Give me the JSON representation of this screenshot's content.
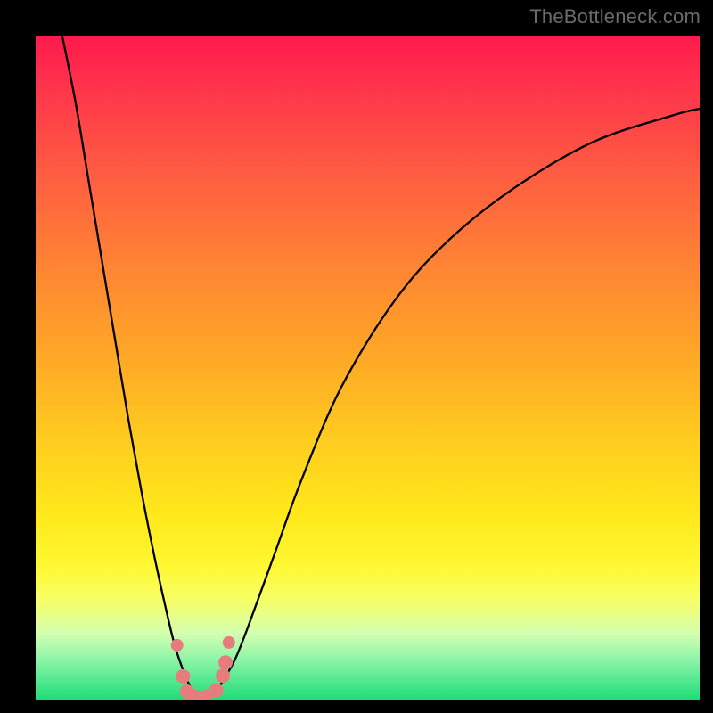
{
  "watermark": "TheBottleneck.com",
  "chart_data": {
    "type": "line",
    "title": "",
    "xlabel": "",
    "ylabel": "",
    "xlim": [
      0,
      100
    ],
    "ylim": [
      0,
      100
    ],
    "grid": false,
    "legend": false,
    "series": [
      {
        "name": "bottleneck-curve",
        "x": [
          4,
          6,
          8,
          10,
          12,
          14,
          16,
          18,
          20,
          21,
          22,
          23,
          24,
          25,
          26,
          27,
          28,
          30,
          32,
          36,
          40,
          46,
          54,
          62,
          72,
          84,
          96,
          100
        ],
        "y": [
          100,
          90,
          78,
          66,
          54,
          42,
          31,
          21,
          12,
          8,
          5,
          2.5,
          1,
          0.4,
          0.4,
          1,
          2.5,
          6,
          11,
          22,
          33,
          47,
          60,
          69,
          77,
          84,
          88,
          89
        ]
      }
    ],
    "markers": {
      "name": "highlight-points",
      "color": "#e77c7c",
      "points": [
        {
          "x": 21.3,
          "y": 8.2
        },
        {
          "x": 22.2,
          "y": 3.5
        },
        {
          "x": 22.8,
          "y": 1.2
        },
        {
          "x": 24.0,
          "y": 0.4
        },
        {
          "x": 25.6,
          "y": 0.4
        },
        {
          "x": 27.2,
          "y": 1.4
        },
        {
          "x": 28.2,
          "y": 3.6
        },
        {
          "x": 28.6,
          "y": 5.6
        },
        {
          "x": 29.1,
          "y": 8.6
        }
      ]
    }
  }
}
